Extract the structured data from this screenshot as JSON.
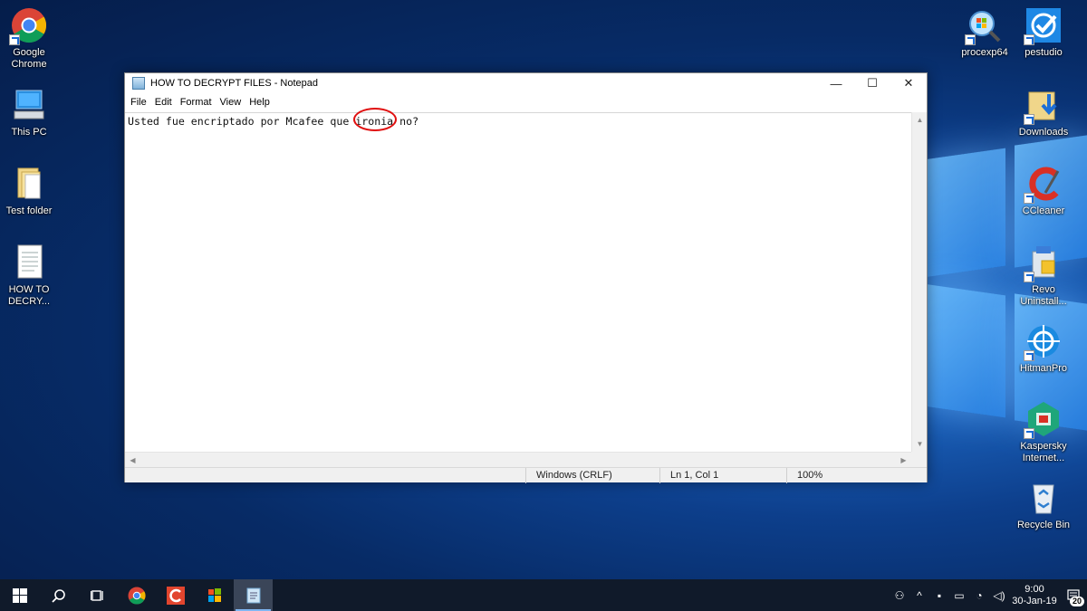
{
  "desktop": {
    "left_icons": [
      {
        "label": "Google Chrome"
      },
      {
        "label": "This PC"
      },
      {
        "label": "Test folder"
      },
      {
        "label": "HOW TO DECRY..."
      }
    ],
    "right_icons": [
      {
        "label": "procexp64"
      },
      {
        "label": "pestudio"
      },
      {
        "label": "Downloads"
      },
      {
        "label": "CCleaner"
      },
      {
        "label": "Revo Uninstall..."
      },
      {
        "label": "HitmanPro"
      },
      {
        "label": "Kaspersky Internet..."
      },
      {
        "label": "Recycle Bin"
      }
    ]
  },
  "notepad": {
    "title": "HOW TO DECRYPT FILES - Notepad",
    "controls": {
      "minimize": "—",
      "maximize": "☐",
      "close": "✕"
    },
    "menu": [
      "File",
      "Edit",
      "Format",
      "View",
      "Help"
    ],
    "content": "Usted fue encriptado por Mcafee que ironia no?",
    "status": {
      "encoding": "Windows (CRLF)",
      "position": "Ln 1, Col 1",
      "zoom": "100%"
    }
  },
  "taskbar": {
    "clock_time": "9:00",
    "clock_date": "30-Jan-19",
    "notification_count": "20"
  },
  "colors": {
    "annotation": "#e01010",
    "taskbar": "#101a2a"
  }
}
